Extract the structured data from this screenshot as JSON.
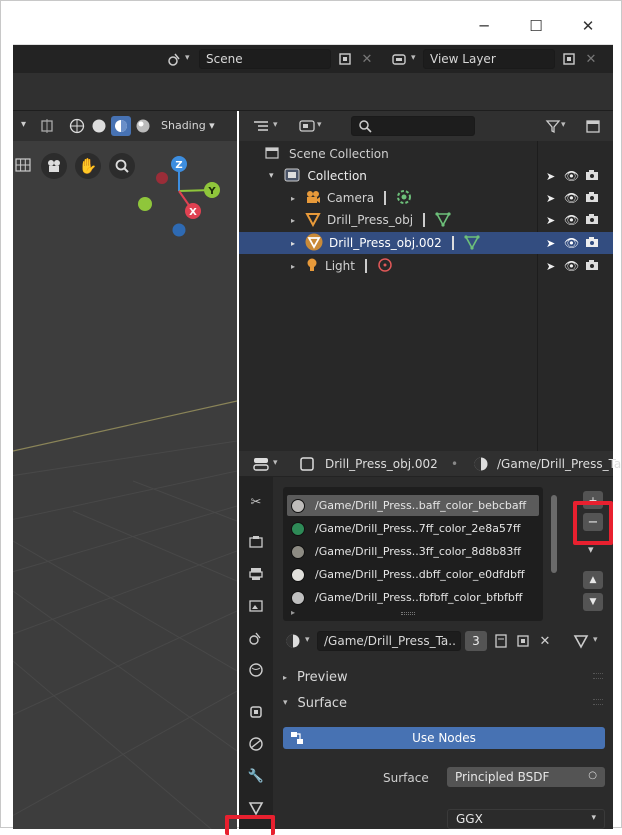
{
  "window": {
    "minimize_glyph": "─",
    "maximize_glyph": "☐",
    "close_glyph": "✕"
  },
  "topbar": {
    "scene": "Scene",
    "view_layer": "View Layer"
  },
  "viewport": {
    "shading_label": "Shading",
    "gizmo": {
      "z": "Z",
      "y": "Y",
      "x": "X"
    }
  },
  "outliner": {
    "scene_collection": "Scene Collection",
    "collection": "Collection",
    "items": [
      {
        "label": "Camera",
        "selected": false
      },
      {
        "label": "Drill_Press_obj",
        "selected": false
      },
      {
        "label": "Drill_Press_obj.002",
        "selected": true
      },
      {
        "label": "Light",
        "selected": false
      }
    ]
  },
  "properties": {
    "object_name": "Drill_Press_obj.002",
    "material_path": "/Game/Drill_Press_Ta",
    "slots": [
      {
        "name": "/Game/Drill_Press..baff_color_bebcbaff",
        "color": "#bebcba",
        "selected": true
      },
      {
        "name": "/Game/Drill_Press..7ff_color_2e8a57ff",
        "color": "#2e8a57",
        "selected": false
      },
      {
        "name": "/Game/Drill_Press..3ff_color_8d8b83ff",
        "color": "#8d8b83",
        "selected": false
      },
      {
        "name": "/Game/Drill_Press..dbff_color_e0dfdbff",
        "color": "#e0dfdb",
        "selected": false
      },
      {
        "name": "/Game/Drill_Press..fbfbff_color_bfbfbff",
        "color": "#bfbfbf",
        "selected": false
      }
    ],
    "material_field": "/Game/Drill_Press_Ta..",
    "user_count": "3",
    "preview_label": "Preview",
    "surface_panel_label": "Surface",
    "use_nodes_label": "Use Nodes",
    "surface_label": "Surface",
    "surface_value": "Principled BSDF",
    "distribution_value": "GGX",
    "add_slot": "+",
    "remove_slot": "−",
    "collapse": "▾",
    "move_up": "▲",
    "move_down": "▼"
  },
  "colors": {
    "accent": "#4772b3",
    "highlight": "#e8202f",
    "selected_row": "#334d80"
  }
}
